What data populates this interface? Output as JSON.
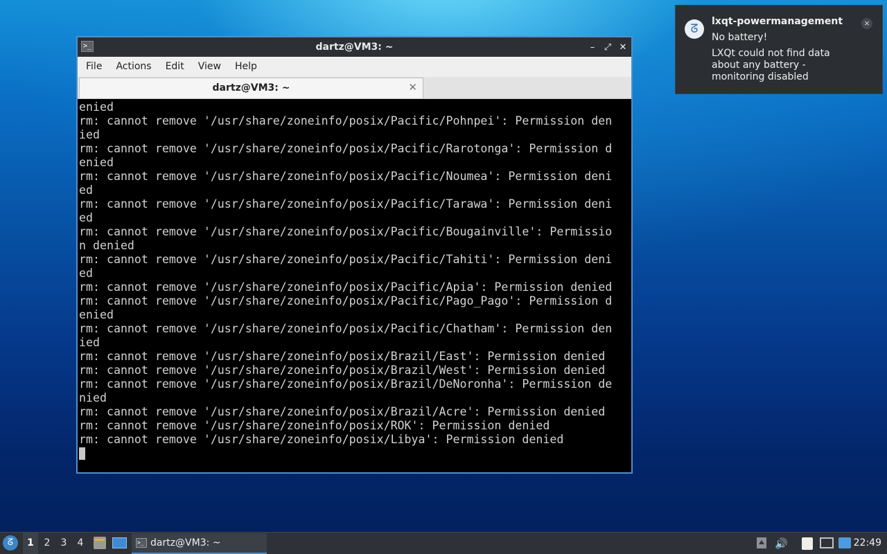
{
  "window": {
    "title": "dartz@VM3: ~",
    "minimize": "–",
    "maximize": "⤢",
    "close": "✕",
    "menu": [
      "File",
      "Actions",
      "Edit",
      "View",
      "Help"
    ],
    "tab_title": "dartz@VM3: ~",
    "tab_close": "✕"
  },
  "terminal": {
    "lines": [
      "enied",
      "rm: cannot remove '/usr/share/zoneinfo/posix/Pacific/Pohnpei': Permission den",
      "ied",
      "rm: cannot remove '/usr/share/zoneinfo/posix/Pacific/Rarotonga': Permission d",
      "enied",
      "rm: cannot remove '/usr/share/zoneinfo/posix/Pacific/Noumea': Permission deni",
      "ed",
      "rm: cannot remove '/usr/share/zoneinfo/posix/Pacific/Tarawa': Permission deni",
      "ed",
      "rm: cannot remove '/usr/share/zoneinfo/posix/Pacific/Bougainville': Permissio",
      "n denied",
      "rm: cannot remove '/usr/share/zoneinfo/posix/Pacific/Tahiti': Permission deni",
      "ed",
      "rm: cannot remove '/usr/share/zoneinfo/posix/Pacific/Apia': Permission denied",
      "rm: cannot remove '/usr/share/zoneinfo/posix/Pacific/Pago_Pago': Permission d",
      "enied",
      "rm: cannot remove '/usr/share/zoneinfo/posix/Pacific/Chatham': Permission den",
      "ied",
      "rm: cannot remove '/usr/share/zoneinfo/posix/Brazil/East': Permission denied",
      "rm: cannot remove '/usr/share/zoneinfo/posix/Brazil/West': Permission denied",
      "rm: cannot remove '/usr/share/zoneinfo/posix/Brazil/DeNoronha': Permission de",
      "nied",
      "rm: cannot remove '/usr/share/zoneinfo/posix/Brazil/Acre': Permission denied",
      "rm: cannot remove '/usr/share/zoneinfo/posix/ROK': Permission denied",
      "rm: cannot remove '/usr/share/zoneinfo/posix/Libya': Permission denied"
    ]
  },
  "notification": {
    "app": "lxqt-powermanagement",
    "summary": "No battery!",
    "body": "LXQt could not find data about any battery - monitoring disabled",
    "close": "×",
    "icon": "lxqt-logo-icon"
  },
  "taskbar": {
    "desktops": [
      "1",
      "2",
      "3",
      "4"
    ],
    "active_desktop": "1",
    "task_label": "dartz@VM3: ~",
    "clock": "22:49",
    "volume_glyph": "🔊",
    "icons": [
      "start-menu-icon",
      "file-manager-icon",
      "show-desktop-icon",
      "terminal-icon",
      "tray-expand-icon",
      "volume-icon",
      "clipboard-icon",
      "network-icon",
      "update-notifier-icon"
    ]
  },
  "colors": {
    "accent": "#4f91cf",
    "titlebar": "#2c3035",
    "taskbar": "#2e3238",
    "terminal_bg": "#000000",
    "terminal_fg": "#d2d2d2"
  }
}
